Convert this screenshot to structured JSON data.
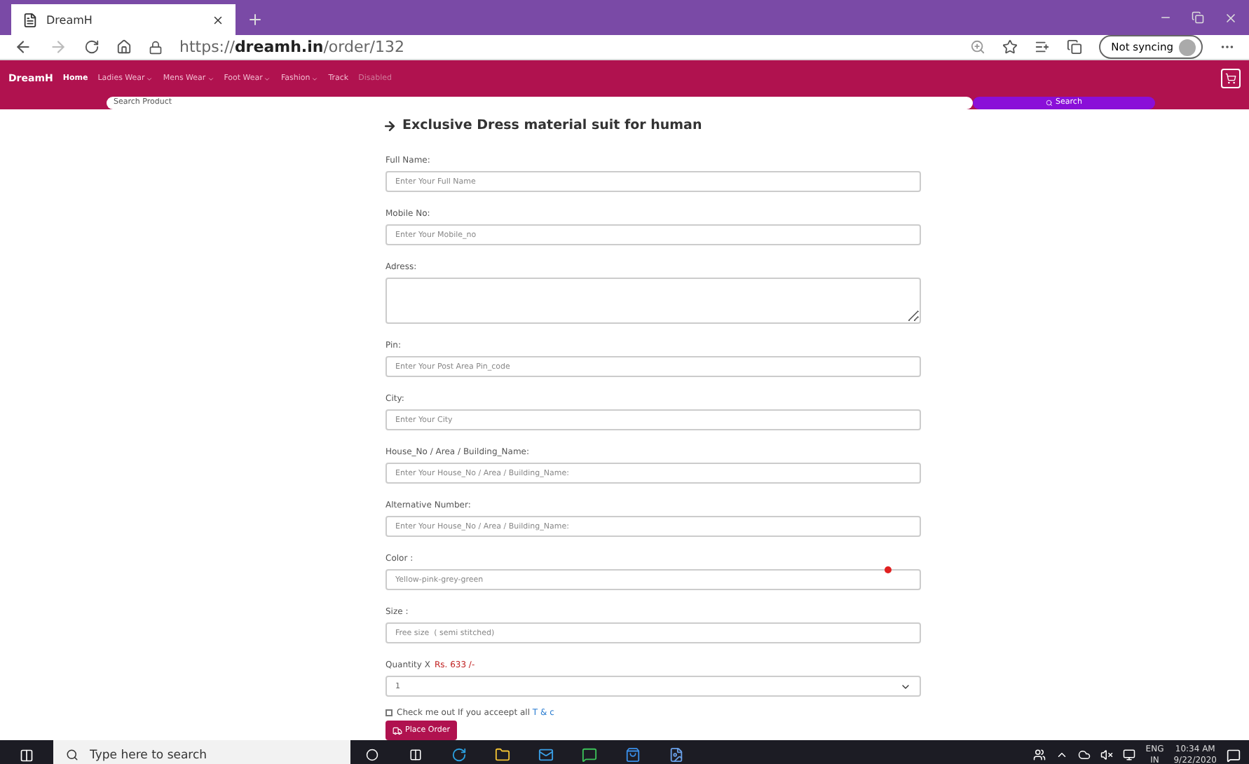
{
  "browser": {
    "tab_title": "DreamH",
    "url_prefix": "https://",
    "url_host": "dreamh.in",
    "url_path": "/order/132",
    "sync_label": "Not syncing"
  },
  "navbar": {
    "brand": "DreamH",
    "items": [
      {
        "label": "Home",
        "selected": true,
        "dropdown": false,
        "disabled": false
      },
      {
        "label": "Ladies Wear",
        "selected": false,
        "dropdown": true,
        "disabled": false
      },
      {
        "label": "Mens Wear",
        "selected": false,
        "dropdown": true,
        "disabled": false
      },
      {
        "label": "Foot Wear",
        "selected": false,
        "dropdown": true,
        "disabled": false
      },
      {
        "label": "Fashion",
        "selected": false,
        "dropdown": true,
        "disabled": false
      },
      {
        "label": "Track",
        "selected": false,
        "dropdown": false,
        "disabled": false
      },
      {
        "label": "Disabled",
        "selected": false,
        "dropdown": false,
        "disabled": true
      }
    ],
    "search_placeholder": "Search Product",
    "search_button": "Search"
  },
  "form": {
    "title": "Exclusive Dress material suit for human",
    "fields": [
      {
        "kind": "text",
        "label": "Full Name:",
        "placeholder": "Enter Your Full Name"
      },
      {
        "kind": "text",
        "label": "Mobile No:",
        "placeholder": "Enter Your Mobile_no"
      },
      {
        "kind": "textarea",
        "label": "Adress:"
      },
      {
        "kind": "text",
        "label": "Pin:",
        "placeholder": "Enter Your Post Area Pin_code"
      },
      {
        "kind": "text",
        "label": "City:",
        "placeholder": "Enter Your City"
      },
      {
        "kind": "text",
        "label": "House_No / Area / Building_Name:",
        "placeholder": "Enter Your House_No / Area / Building_Name:"
      },
      {
        "kind": "text",
        "label": "Alternative Number:",
        "placeholder": "Enter Your House_No / Area / Building_Name:"
      },
      {
        "kind": "text",
        "label": "Color :",
        "placeholder": "Yellow-pink-grey-green"
      },
      {
        "kind": "text",
        "label": "Size :",
        "placeholder": "Free size  ( semi stitched)"
      },
      {
        "kind": "select",
        "label": "Quantity X",
        "price": "Rs. 633 /-",
        "value": "1"
      }
    ],
    "terms": {
      "checked": false,
      "text": "Check me out If you acceept all",
      "link": "T & c"
    },
    "submit": "Place Order"
  },
  "taskbar": {
    "search_placeholder": "Type here to search",
    "language": "ENG",
    "region": "IN",
    "time": "10:34 AM",
    "date": "9/22/2020"
  }
}
